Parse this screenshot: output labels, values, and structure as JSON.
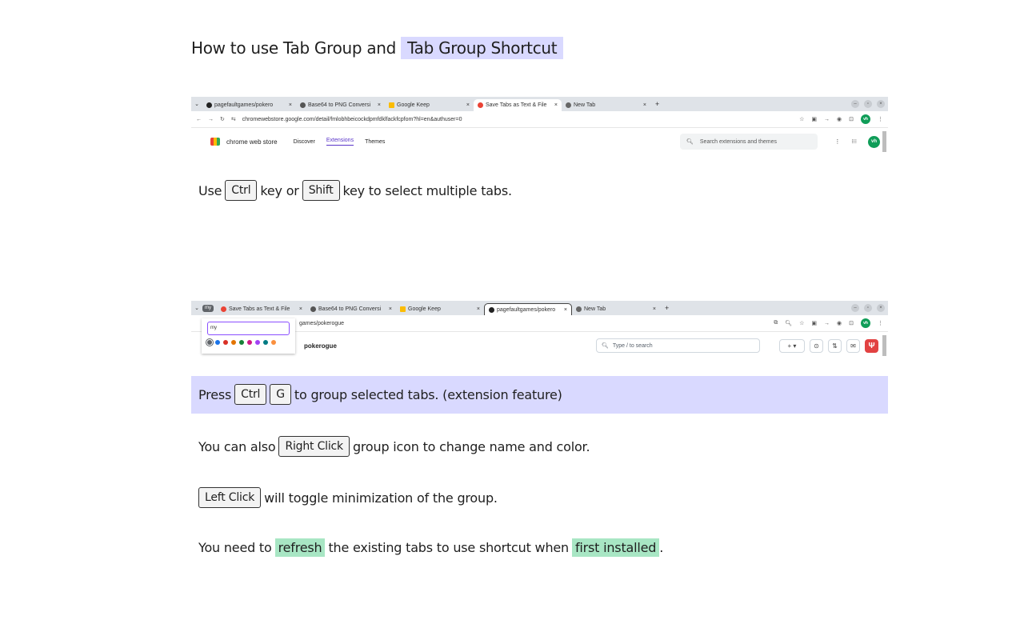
{
  "heading": {
    "text": "How to use Tab Group and",
    "highlight": "Tab Group Shortcut"
  },
  "shot1": {
    "tabs": [
      {
        "label": "pagefaultgames/pokero",
        "icon": "github-icon",
        "active": false
      },
      {
        "label": "Base64 to PNG Conversi",
        "icon": "globe-icon",
        "active": false
      },
      {
        "label": "Google Keep",
        "icon": "keep-icon",
        "active": false
      },
      {
        "label": "Save Tabs as Text & File",
        "icon": "extension-icon",
        "active": true
      },
      {
        "label": "New Tab",
        "icon": "chrome-icon",
        "active": false
      }
    ],
    "url": "chromewebstore.google.com/detail/fmlobhbeicockdpmfdklfackfcpfom?hl=en&authuser=0",
    "store_name": "chrome web store",
    "nav": [
      "Discover",
      "Extensions",
      "Themes"
    ],
    "search_placeholder": "Search extensions and themes",
    "avatar": "vh"
  },
  "line1": {
    "pre": "Use",
    "key1": "Ctrl",
    "mid": "key or",
    "key2": "Shift",
    "post": "key to select multiple tabs."
  },
  "shot2": {
    "group_name": "my",
    "tabs": [
      {
        "label": "Save Tabs as Text & File",
        "icon": "extension-icon",
        "active": false
      },
      {
        "label": "Base64 to PNG Conversi",
        "icon": "globe-icon",
        "active": false
      },
      {
        "label": "Google Keep",
        "icon": "keep-icon",
        "active": false
      },
      {
        "label": "pagefaultgames/pokero",
        "icon": "github-icon",
        "active": true
      },
      {
        "label": "New Tab",
        "icon": "chrome-icon",
        "active": false
      }
    ],
    "url": "games/pokerogue",
    "popup_input": "my",
    "colors": [
      "#5f6368",
      "#1a73e8",
      "#d93025",
      "#e37400",
      "#188038",
      "#d01884",
      "#a142f4",
      "#007b83",
      "#fa903e"
    ],
    "repo_name": "pokerogue",
    "search_hint": "Type / to search",
    "avatar": "vh"
  },
  "line2": {
    "pre": "Press",
    "key1": "Ctrl",
    "key2": "G",
    "post": "to group selected tabs. (extension feature)"
  },
  "line3": {
    "pre": "You can also",
    "key": "Right Click",
    "post": "group icon to change name and color."
  },
  "line4": {
    "key": "Left Click",
    "post": "will toggle minimization of the group."
  },
  "line5": {
    "pre": "You need to",
    "mark1": "refresh",
    "mid": "the existing tabs to use shortcut when",
    "mark2": "first installed",
    "post": "."
  }
}
